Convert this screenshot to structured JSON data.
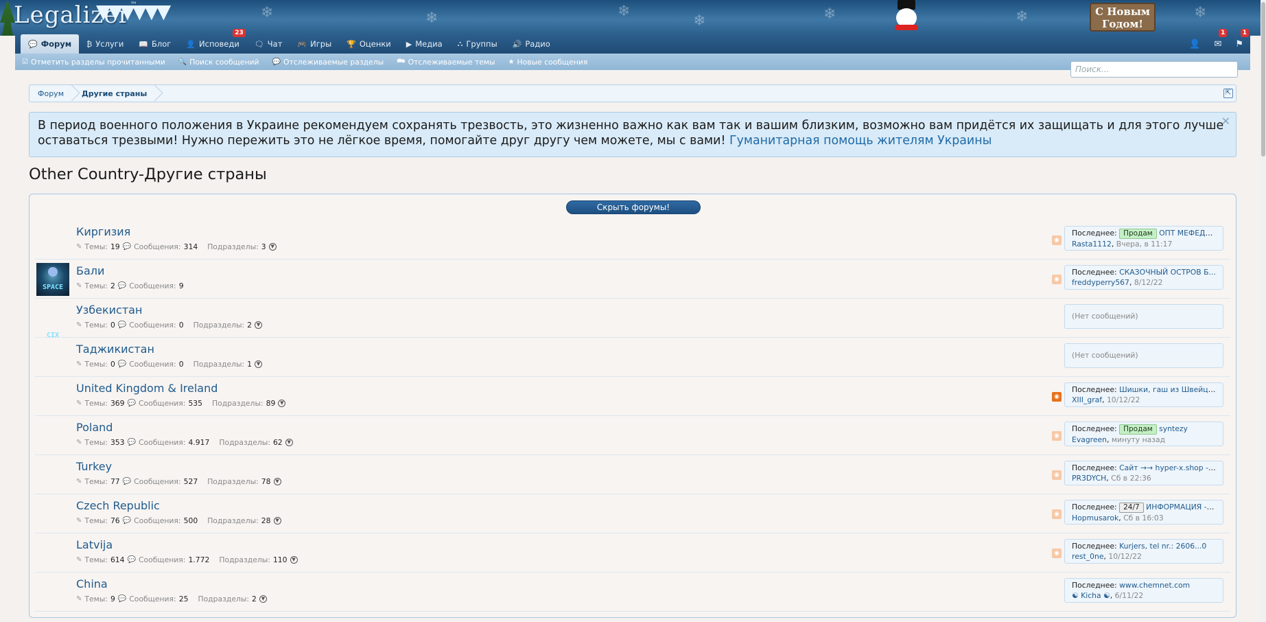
{
  "header": {
    "logo": "Legalizer",
    "logo_mark": "™",
    "new_year_sign": "С Новым Годом!"
  },
  "nav": {
    "items": [
      {
        "label": "Форум",
        "icon": "chat-bubbles-icon",
        "active": true
      },
      {
        "label": "Услуги",
        "icon": "bitcoin-icon"
      },
      {
        "label": "Блог",
        "icon": "book-icon"
      },
      {
        "label": "Исповеди",
        "icon": "person-icon",
        "badge": "23"
      },
      {
        "label": "Чат",
        "icon": "chat-icon"
      },
      {
        "label": "Игры",
        "icon": "gamepad-icon"
      },
      {
        "label": "Оценки",
        "icon": "trophy-icon"
      },
      {
        "label": "Медиа",
        "icon": "youtube-icon"
      },
      {
        "label": "Группы",
        "icon": "sitemap-icon"
      },
      {
        "label": "Радио",
        "icon": "speaker-icon"
      }
    ],
    "right": {
      "messages_badge": "1",
      "alerts_badge": "1"
    }
  },
  "subnav": {
    "items": [
      {
        "label": "Отметить разделы прочитанными",
        "icon": "check-icon"
      },
      {
        "label": "Поиск сообщений",
        "icon": "search-icon"
      },
      {
        "label": "Отслеживаемые разделы",
        "icon": "comment-icon"
      },
      {
        "label": "Отслеживаемые темы",
        "icon": "comments-icon"
      },
      {
        "label": "Новые сообщения",
        "icon": "star-icon"
      }
    ]
  },
  "search": {
    "placeholder": "Поиск..."
  },
  "breadcrumb": {
    "items": [
      "Форум",
      "Другие страны"
    ]
  },
  "notice": {
    "text": "В период военного положения в Украине рекомендуем сохранять трезвость, это жизненно важно как вам так и вашим близким, возможно вам придётся их защищать и для этого лучше оставаться трезвыми! Нужно пережить это не лёгкое время, помогайте друг другу чем можете, мы с вами!",
    "link": "Гуманитарная помощь жителям Украины"
  },
  "page_title": "Other Country-Другие страны",
  "hide_button": "Скрыть форумы!",
  "labels": {
    "topics": "Темы:",
    "messages": "Сообщения:",
    "subforums": "Подразделы:",
    "last": "Последнее:",
    "no_messages": "(Нет сообщений)"
  },
  "forums": [
    {
      "title": "Киргизия",
      "topics": "19",
      "messages": "314",
      "subforums": "3",
      "last_tag": "Продам",
      "last_tag_type": "sell",
      "last_title": "ОПТ МЕФЕДР...",
      "last_user": "Rasta1112",
      "last_time": "Вчера, в 11:17",
      "rss_on": false
    },
    {
      "title": "Бали",
      "topics": "2",
      "messages": "9",
      "subforums": "",
      "last_title": "СКАЗОЧНЫЙ ОСТРОВ Б...",
      "last_user": "freddyperry567",
      "last_time": "8/12/22",
      "avatar": "SPACE CIX",
      "rss_on": false
    },
    {
      "title": "Узбекистан",
      "topics": "0",
      "messages": "0",
      "subforums": "2",
      "empty": true
    },
    {
      "title": "Таджикистан",
      "topics": "0",
      "messages": "0",
      "subforums": "1",
      "empty": true
    },
    {
      "title": "United Kingdom & Ireland",
      "topics": "369",
      "messages": "535",
      "subforums": "89",
      "last_title": "Шишки, гаш из Швейцари...",
      "last_user": "XIII_graf",
      "last_time": "10/12/22",
      "rss_on": true
    },
    {
      "title": "Poland",
      "topics": "353",
      "messages": "4.917",
      "subforums": "62",
      "last_tag": "Продам",
      "last_tag_type": "sell",
      "last_title": "syntezy",
      "last_user": "Evagreen",
      "last_time": "минуту назад",
      "rss_on": false
    },
    {
      "title": "Turkey",
      "topics": "77",
      "messages": "527",
      "subforums": "78",
      "last_title": "Сайт →→ hyper-x.shop - А...",
      "last_user": "PR3DYCH",
      "last_time": "Сб в 22:36",
      "rss_on": false
    },
    {
      "title": "Czech Republic",
      "topics": "76",
      "messages": "500",
      "subforums": "28",
      "last_tag": "24/7",
      "last_tag_type": "h24",
      "last_title": "ИНФОРМАЦИЯ ---...",
      "last_user": "Hopmusarok",
      "last_time": "Сб в 16:03",
      "rss_on": false
    },
    {
      "title": "Latvija",
      "topics": "614",
      "messages": "1.772",
      "subforums": "110",
      "last_title": "Kurjers, tel nr.: 2606...0",
      "last_user": "rest_0ne",
      "last_time": "10/12/22",
      "rss_on": false
    },
    {
      "title": "China",
      "topics": "9",
      "messages": "25",
      "subforums": "2",
      "last_title": "www.chemnet.com",
      "last_user": "☯ Kicha ☯",
      "last_time": "6/11/22",
      "no_rss": true
    }
  ]
}
